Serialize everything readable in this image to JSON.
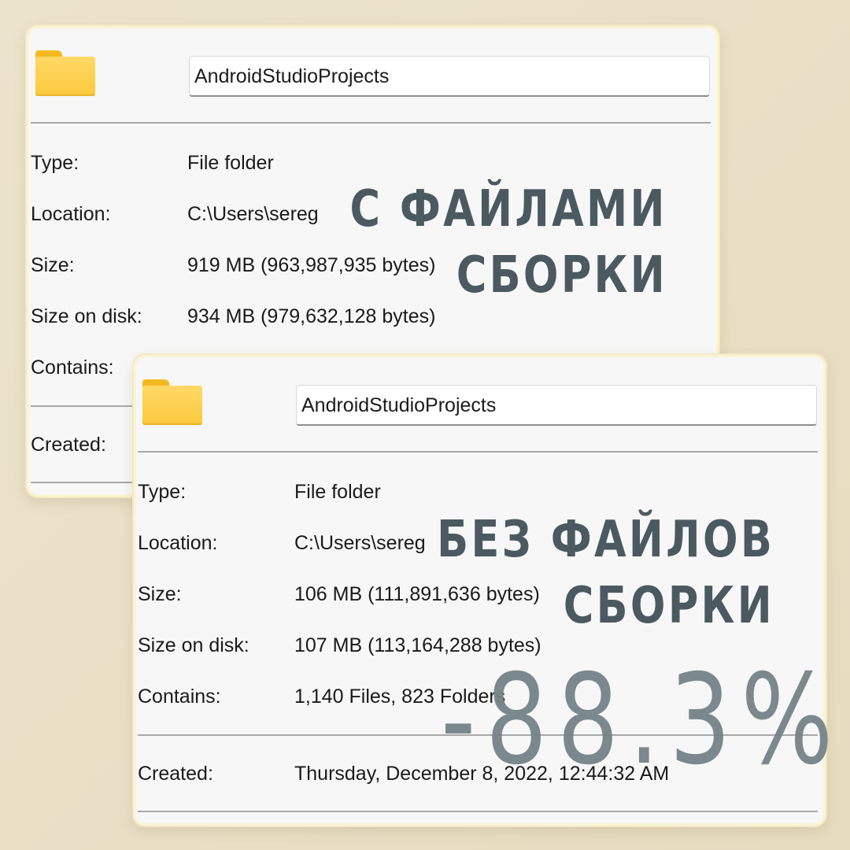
{
  "panel_before": {
    "folder_name": "AndroidStudioProjects",
    "labels": {
      "type": "Type:",
      "location": "Location:",
      "size": "Size:",
      "size_on_disk": "Size on disk:",
      "contains": "Contains:",
      "created": "Created:"
    },
    "values": {
      "type": "File folder",
      "location": "C:\\Users\\sereg",
      "size": "919 MB (963,987,935 bytes)",
      "size_on_disk": "934 MB (979,632,128 bytes)"
    },
    "icon": "folder-icon"
  },
  "panel_after": {
    "folder_name": "AndroidStudioProjects",
    "labels": {
      "type": "Type:",
      "location": "Location:",
      "size": "Size:",
      "size_on_disk": "Size on disk:",
      "contains": "Contains:",
      "created": "Created:"
    },
    "values": {
      "type": "File folder",
      "location": "C:\\Users\\sereg",
      "size": "106 MB (111,891,636 bytes)",
      "size_on_disk": "107 MB (113,164,288 bytes)",
      "contains": "1,140 Files, 823 Folders",
      "created": "Thursday, December 8, 2022, 12:44:32 AM"
    },
    "icon": "folder-icon"
  },
  "overlay": {
    "with_build_line1": "С ФАЙЛАМИ",
    "with_build_line2": "СБОРКИ",
    "without_build_line1": "БЕЗ ФАЙЛОВ",
    "without_build_line2": "СБОРКИ",
    "reduction": "-88.3%"
  },
  "colors": {
    "background": "#e8dfc6",
    "panel_bg": "#f7f7f7",
    "overlay_text": "#4b5a60",
    "percent_text": "#758489",
    "folder_yellow": "#fbc93c"
  }
}
